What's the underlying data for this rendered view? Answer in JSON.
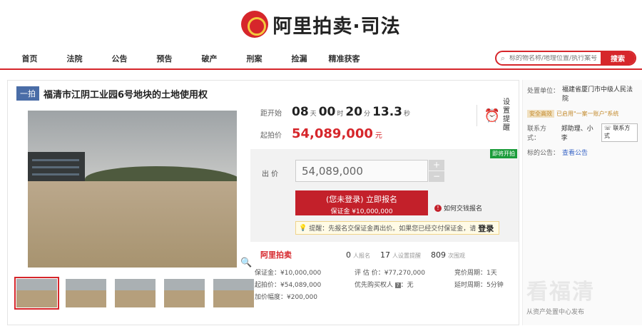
{
  "header": {
    "logo_text": "阿里拍卖·司法"
  },
  "nav": {
    "items": [
      "首页",
      "法院",
      "公告",
      "预告",
      "破产",
      "刑案",
      "捡漏",
      "精准获客"
    ],
    "search_placeholder": "标的物名称/地理位置/执行案号",
    "search_button": "搜索"
  },
  "item": {
    "badge": "一拍",
    "title": "福清市江阴工业园6号地块的土地使用权"
  },
  "countdown": {
    "label": "距开始",
    "days": "08",
    "days_unit": "天",
    "hours": "00",
    "hours_unit": "时",
    "minutes": "20",
    "minutes_unit": "分",
    "seconds": "13.3",
    "seconds_unit": "秒",
    "reminder_label": "设置提醒"
  },
  "start_price": {
    "label": "起拍价",
    "value": "54,089,000",
    "unit": "元"
  },
  "bid": {
    "tag": "即将开拍",
    "label": "出 价",
    "input_value": "54,089,000",
    "plus": "+",
    "minus": "−",
    "signup_main": "(您未登录) 立即报名",
    "signup_sub": "保证金 ¥10,000,000",
    "howto": "如何交钱报名",
    "notice_prefix": "提醒：先报名交保证金再出价。如果您已经交付保证金，请",
    "notice_link": "登录"
  },
  "stats": {
    "brand": "阿里拍卖",
    "signups": "0",
    "signups_label": "人报名",
    "reminders": "17",
    "reminders_label": "人设置提醒",
    "views": "809",
    "views_label": "次围观"
  },
  "details": {
    "col1": [
      "保证金：¥10,000,000",
      "起拍价：¥54,089,000",
      "加价幅度：¥200,000"
    ],
    "col2": [
      "评 估 价：¥77,270,000",
      "优先购买权人 ",
      "：无"
    ],
    "col3": [
      "竞价周期：1天",
      "延时周期：5分钟"
    ]
  },
  "side": {
    "court_label": "处置单位：",
    "court": "福建省厦门市中级人民法院",
    "verified_badge": "安全高效",
    "verified_text": "已启用\"一案一账户\"系统",
    "contact_label": "联系方式：",
    "contact": "郑助理、小李",
    "contact_button": "联系方式",
    "notice_label": "标的公告：",
    "notice_link": "查看公告"
  },
  "watermark": {
    "main": "看福清",
    "sub": "从资产处置中心发布"
  }
}
